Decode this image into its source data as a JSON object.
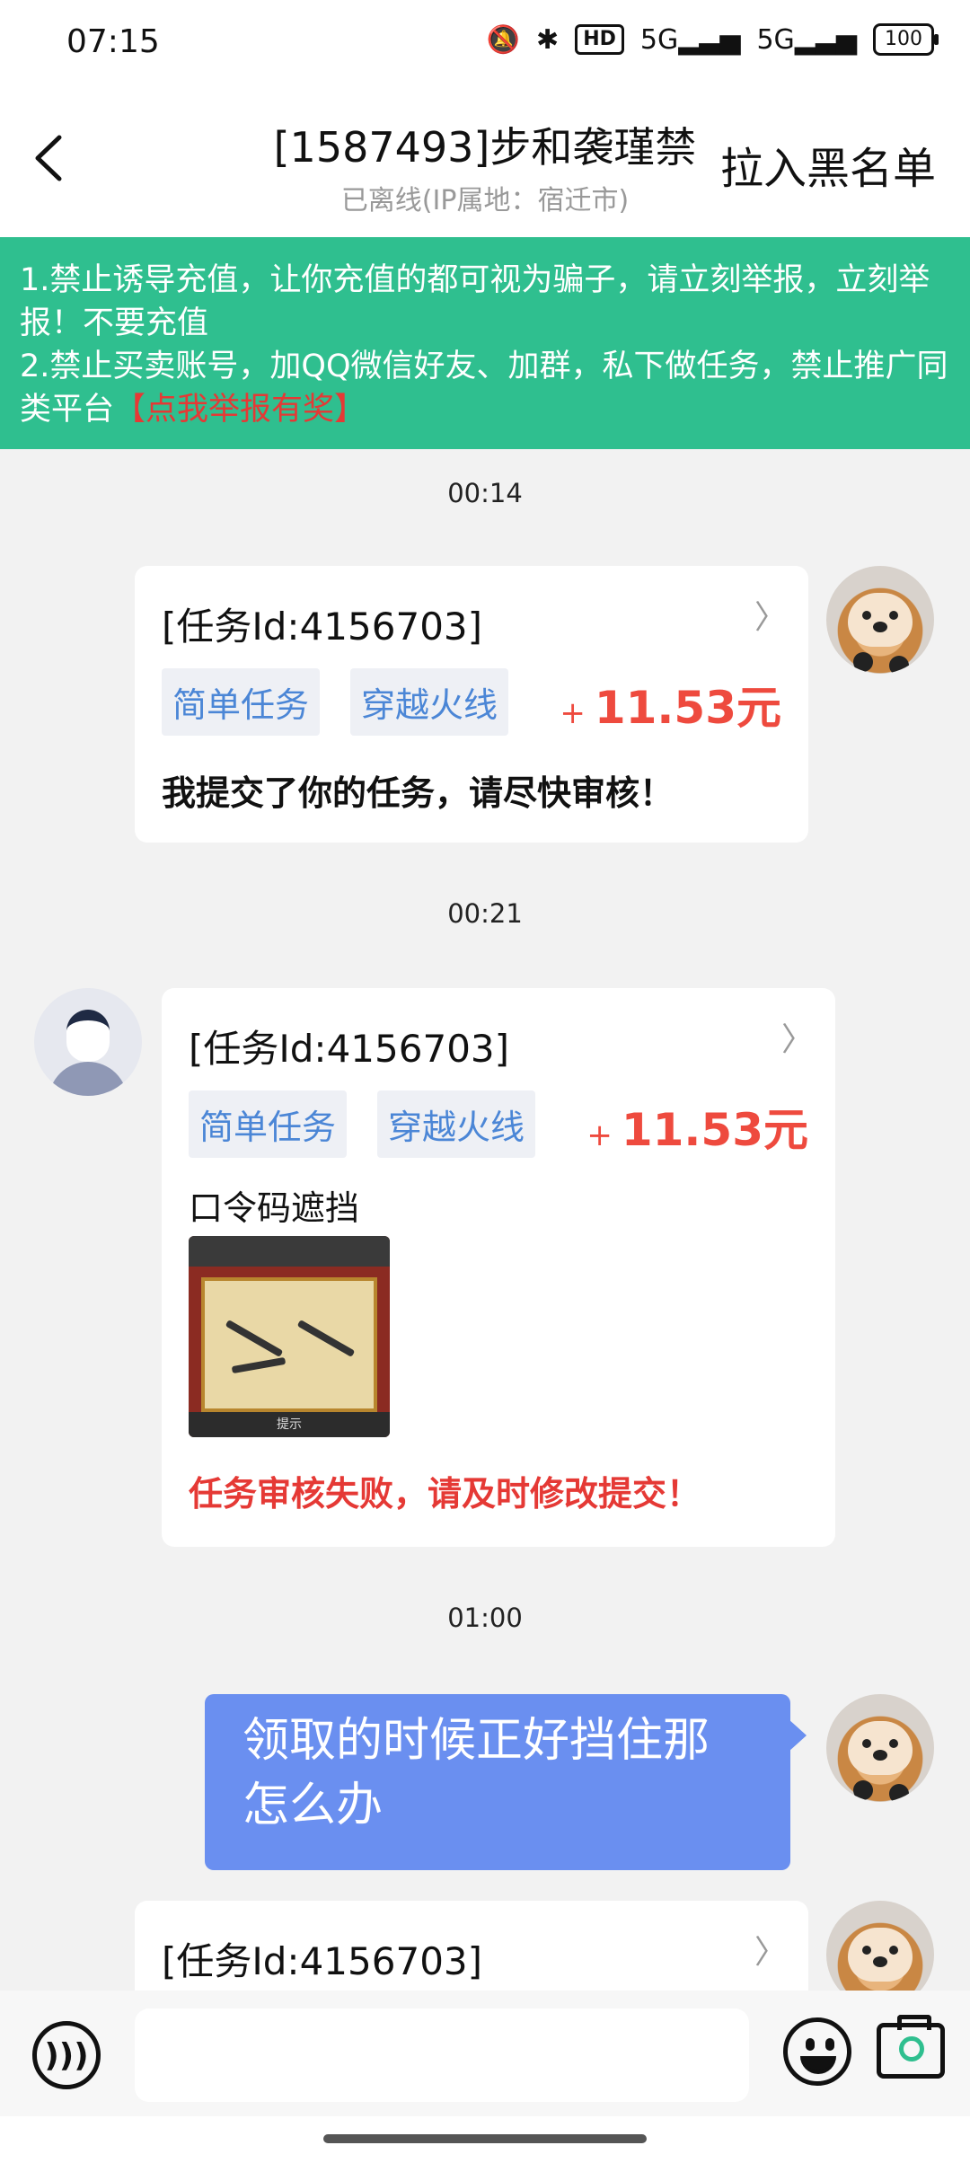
{
  "status_bar": {
    "time": "07:15",
    "mute_icon": "bell-off-icon",
    "bluetooth_icon": "bluetooth-icon",
    "hd_label": "HD",
    "signal1": "5G",
    "signal2": "5G",
    "battery": "100"
  },
  "header": {
    "back_icon": "chevron-left-icon",
    "title": "[1587493]步和袭瑾禁",
    "subtitle": "已离线(IP属地：宿迁市)",
    "blacklist_label": "拉入黑名单"
  },
  "notice": {
    "line1": "1.禁止诱导充值，让你充值的都可视为骗子，请立刻举报，立刻举报！不要充值",
    "line2": "2.禁止买卖账号，加QQ微信好友、加群，私下做任务，禁止推广同类平台",
    "report_link": "【点我举报有奖】"
  },
  "messages": [
    {
      "timestamp": "00:14",
      "task_id": "[任务Id:4156703]",
      "tag1": "简单任务",
      "tag2": "穿越火线",
      "amount_plus": "+",
      "amount": "11.53元",
      "text": "我提交了你的任务，请尽快审核！"
    },
    {
      "timestamp": "00:21",
      "task_id": "[任务Id:4156703]",
      "tag1": "简单任务",
      "tag2": "穿越火线",
      "amount_plus": "+",
      "amount": "11.53元",
      "note": "口令码遮挡",
      "thumb_caption": "提示",
      "status": "任务审核失败，请及时修改提交！"
    },
    {
      "timestamp": "01:00",
      "text": "领取的时候正好挡住那怎么办"
    },
    {
      "task_id": "[任务Id:4156703]"
    }
  ],
  "input_bar": {
    "voice_icon": "voice-icon",
    "placeholder": "",
    "emoji_icon": "emoji-icon",
    "camera_icon": "camera-icon"
  },
  "colors": {
    "notice_bg": "#2fbf8f",
    "amount": "#ee4a3e",
    "tag_text": "#4b86d6",
    "bubble": "#6a8ff0",
    "fail": "#e53935"
  }
}
